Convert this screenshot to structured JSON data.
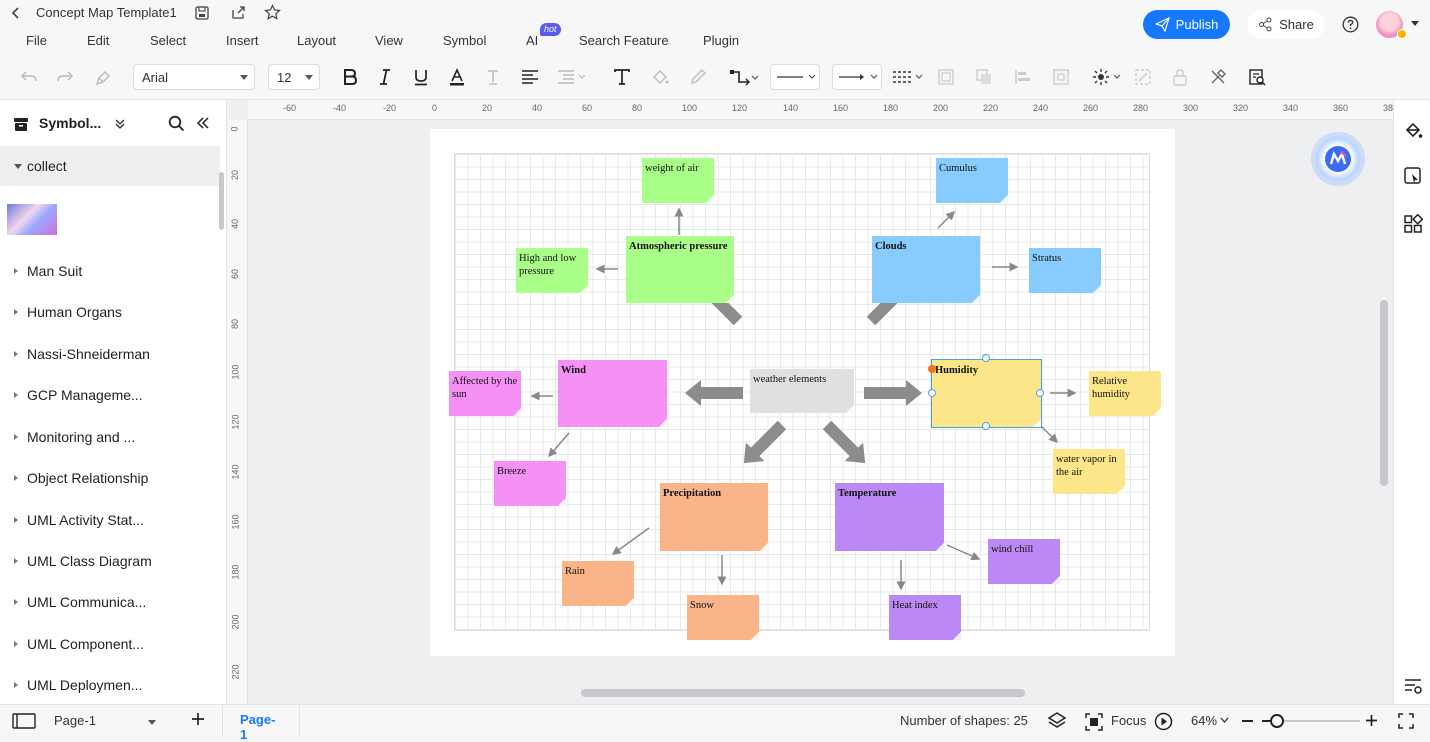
{
  "app": {
    "document_title": "Concept Map Template1",
    "publish_label": "Publish",
    "share_label": "Share",
    "accent": "#1677ff"
  },
  "menu": {
    "items": [
      "File",
      "Edit",
      "Select",
      "Insert",
      "Layout",
      "View",
      "Symbol",
      "AI",
      "Search Feature",
      "Plugin"
    ],
    "ai_badge": "hot"
  },
  "toolbar": {
    "font_family": "Arial",
    "font_size": "12"
  },
  "sidebar": {
    "title": "Symbol...",
    "collect_label": "collect",
    "libraries": [
      "Man Suit",
      "Human Organs",
      "Nassi-Shneiderman",
      "GCP Manageme...",
      "Monitoring and ...",
      "Object Relationship",
      "UML Activity Stat...",
      "UML Class Diagram",
      "UML Communica...",
      "UML Component...",
      "UML Deploymen..."
    ]
  },
  "rulers": {
    "horizontal": [
      "-60",
      "-40",
      "-20",
      "0",
      "20",
      "40",
      "60",
      "80",
      "100",
      "120",
      "140",
      "160",
      "180",
      "200",
      "220",
      "240",
      "260",
      "280",
      "300",
      "320",
      "340",
      "360",
      "38"
    ],
    "vertical": [
      "0",
      "20",
      "40",
      "60",
      "80",
      "100",
      "120",
      "140",
      "160",
      "180",
      "200",
      "220"
    ]
  },
  "diagram": {
    "center": "weather elements",
    "nodes": {
      "weight_of_air": "weight of air",
      "atmospheric_pressure": "Atmospheric pressure",
      "high_low_pressure": "High and low pressure",
      "cumulus": "Cumulus",
      "clouds": "Clouds",
      "stratus": "Stratus",
      "affected_by_sun": "Affected by the sun",
      "wind": "Wind",
      "breeze": "Breeze",
      "humidity": "Humidity",
      "relative_humidity": "Relative humidity",
      "water_vapor": "water vapor in the air",
      "precipitation": "Precipitation",
      "rain": "Rain",
      "snow": "Snow",
      "temperature": "Temperature",
      "wind_chill": "wind chill",
      "heat_index": "Heat index"
    },
    "colors": {
      "green": "#aaff88",
      "blue": "#88ccff",
      "pink": "#f590f5",
      "yellow": "#fde68a",
      "orange": "#f9b48a",
      "purple": "#bb88f5",
      "center": "#e0e0e0"
    }
  },
  "statusbar": {
    "page_selector": "Page-1",
    "active_page_tab": "Page-1",
    "shapes_count": "Number of shapes: 25",
    "focus_label": "Focus",
    "zoom": "64%"
  }
}
